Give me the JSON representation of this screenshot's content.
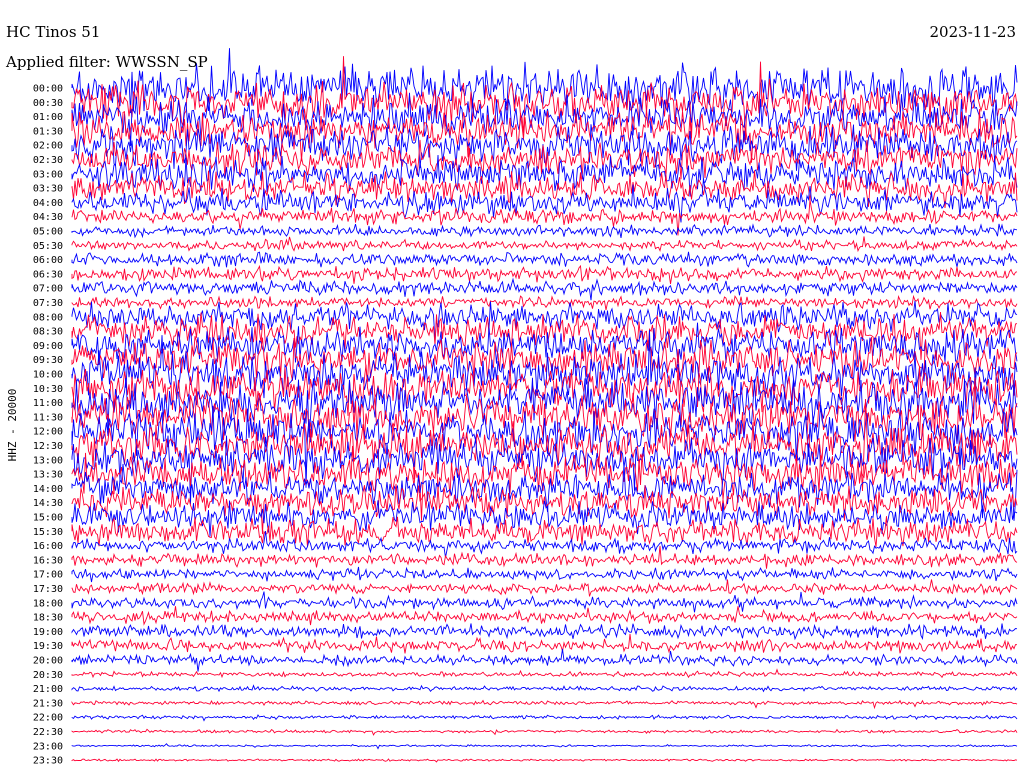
{
  "header": {
    "station": "HC Tinos 51",
    "date": "2023-11-23",
    "filter": "Applied filter: WWSSN_SP"
  },
  "chart_data": {
    "type": "line",
    "title": "HC Tinos 51",
    "subtitle": "Applied filter: WWSSN_SP",
    "date": "2023-11-23",
    "ylabel": "HHZ - 20000",
    "xlabel": "",
    "grid": false,
    "row_colors": [
      "#0000ff",
      "#ff0033"
    ],
    "rows": [
      "00:00",
      "00:30",
      "01:00",
      "01:30",
      "02:00",
      "02:30",
      "03:00",
      "03:30",
      "04:00",
      "04:30",
      "05:00",
      "05:30",
      "06:00",
      "06:30",
      "07:00",
      "07:30",
      "08:00",
      "08:30",
      "09:00",
      "09:30",
      "10:00",
      "10:30",
      "11:00",
      "11:30",
      "12:00",
      "12:30",
      "13:00",
      "13:30",
      "14:00",
      "14:30",
      "15:00",
      "15:30",
      "16:00",
      "16:30",
      "17:00",
      "17:30",
      "18:00",
      "18:30",
      "19:00",
      "19:30",
      "20:00",
      "20:30",
      "21:00",
      "21:30",
      "22:00",
      "22:30",
      "23:00",
      "23:30"
    ],
    "relative_amplitude": [
      4.2,
      3.8,
      3.8,
      3.6,
      3.5,
      3.3,
      3.1,
      3.0,
      2.4,
      1.6,
      1.1,
      1.0,
      1.3,
      1.4,
      1.4,
      1.1,
      2.6,
      3.2,
      3.6,
      3.8,
      4.0,
      4.1,
      4.3,
      4.1,
      4.2,
      4.0,
      3.8,
      3.5,
      3.2,
      3.0,
      2.8,
      2.5,
      1.4,
      1.2,
      1.1,
      1.0,
      1.1,
      1.2,
      1.3,
      1.2,
      1.0,
      0.5,
      0.45,
      0.4,
      0.35,
      0.3,
      0.2,
      0.2
    ]
  }
}
